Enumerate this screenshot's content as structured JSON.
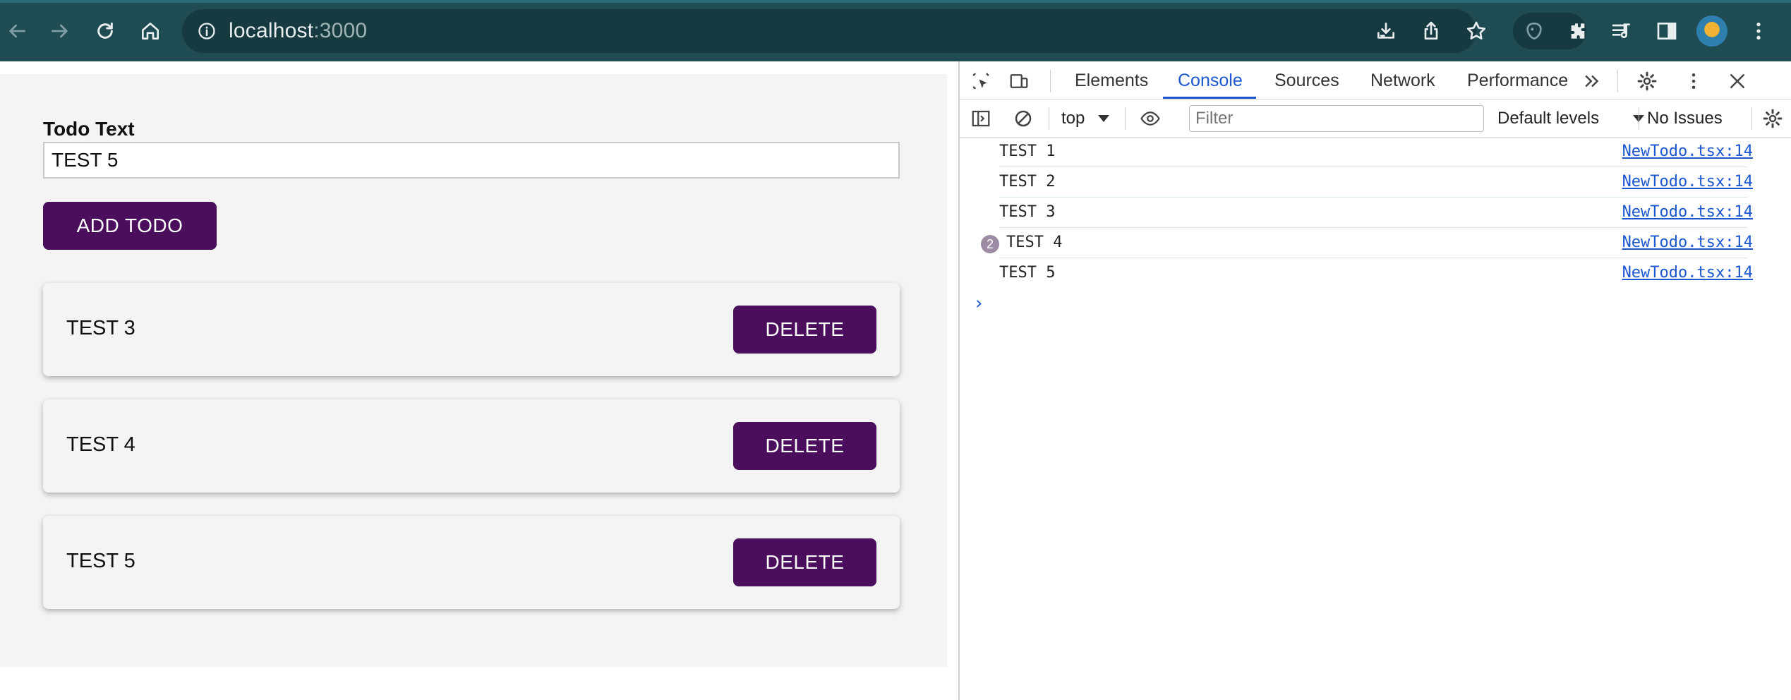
{
  "browser": {
    "url_host": "localhost",
    "url_port": ":3000"
  },
  "app": {
    "field_label": "Todo Text",
    "input_value": "TEST 5",
    "add_button_label": "ADD TODO",
    "todos": [
      {
        "text": "TEST 3",
        "delete_label": "DELETE"
      },
      {
        "text": "TEST 4",
        "delete_label": "DELETE"
      },
      {
        "text": "TEST 5",
        "delete_label": "DELETE"
      }
    ]
  },
  "devtools": {
    "tabs": [
      "Elements",
      "Console",
      "Sources",
      "Network",
      "Performance"
    ],
    "active_tab": "Console",
    "context": "top",
    "filter_placeholder": "Filter",
    "levels": "Default levels",
    "issues": "No Issues",
    "logs": [
      {
        "text": "TEST 1",
        "source": "NewTodo.tsx:14",
        "count": ""
      },
      {
        "text": "TEST 2",
        "source": "NewTodo.tsx:14",
        "count": ""
      },
      {
        "text": "TEST 3",
        "source": "NewTodo.tsx:14",
        "count": ""
      },
      {
        "text": "TEST 4",
        "source": "NewTodo.tsx:14",
        "count": "2"
      },
      {
        "text": "TEST 5",
        "source": "NewTodo.tsx:14",
        "count": ""
      }
    ],
    "prompt_symbol": "›"
  },
  "colors": {
    "chrome_bg": "#1f4b53",
    "button_purple": "#4a0e5c",
    "devtools_accent": "#1a57d0"
  },
  "icons": [
    "back-icon",
    "forward-icon",
    "reload-icon",
    "home-icon",
    "site-info-icon",
    "download-icon",
    "share-icon",
    "bookmark-star-icon",
    "extension-icon",
    "puzzle-icon",
    "media-queue-icon",
    "side-panel-icon",
    "profile-avatar",
    "kebab-menu-icon"
  ]
}
